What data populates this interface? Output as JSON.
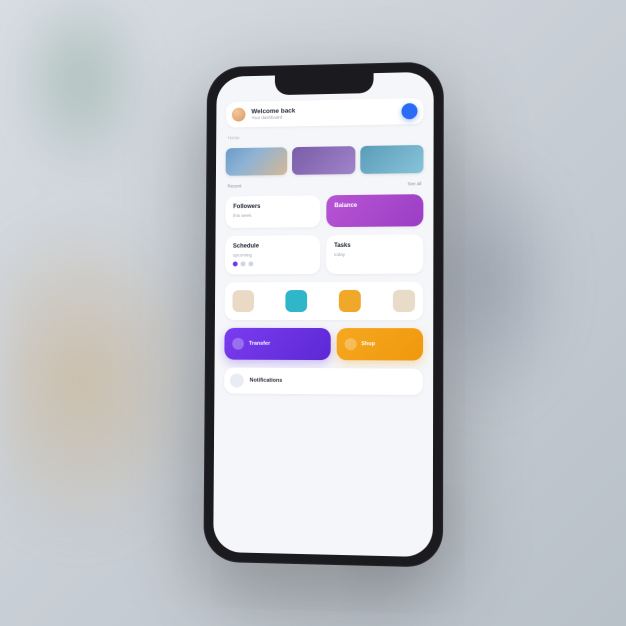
{
  "colors": {
    "primary": "#2a6cf6",
    "accent_purple": "#7a3cf0",
    "accent_orange": "#f5a820",
    "accent_pink": "#b854d4"
  },
  "header": {
    "title": "Welcome back",
    "subtitle": "Your dashboard"
  },
  "breadcrumb": "Home",
  "media": {
    "thumbs": [
      "thumb-1",
      "thumb-2",
      "thumb-3"
    ],
    "meta_left": "Recent",
    "meta_right": "See all"
  },
  "stats": {
    "left": {
      "label": "Followers",
      "sub": "this week",
      "value": ""
    },
    "right": {
      "label": "Balance",
      "value": ""
    }
  },
  "activity": {
    "left": {
      "label": "Schedule",
      "sub": "upcoming"
    },
    "right": {
      "label": "Tasks",
      "sub": "today"
    }
  },
  "people": [
    {
      "name": "person-1",
      "icon": "avatar-icon"
    },
    {
      "name": "person-2",
      "icon": "avatar-icon"
    },
    {
      "name": "person-3",
      "icon": "avatar-icon"
    },
    {
      "name": "person-4",
      "icon": "avatar-icon"
    }
  ],
  "actions": {
    "primary": {
      "label": "Transfer",
      "icon": "send-icon"
    },
    "secondary": {
      "label": "Shop",
      "icon": "cart-icon"
    }
  },
  "list": {
    "item_label": "Notifications"
  }
}
